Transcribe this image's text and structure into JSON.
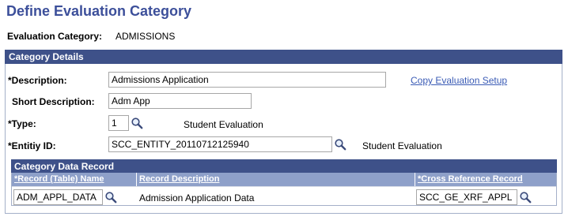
{
  "page_title": "Define Evaluation Category",
  "evaluation_category": {
    "label": "Evaluation Category:",
    "value": "ADMISSIONS"
  },
  "category_details": {
    "header": "Category Details",
    "description": {
      "label": "*Description:",
      "value": "Admissions Application"
    },
    "copy_link": "Copy Evaluation Setup",
    "short_description": {
      "label": "Short Description:",
      "value": "Adm App"
    },
    "type": {
      "label": "*Type:",
      "value": "1",
      "desc": "Student Evaluation"
    },
    "entity_id": {
      "label": "*Entitiy ID:",
      "value": "SCC_ENTITY_20110712125940",
      "desc": "Student Evaluation"
    }
  },
  "data_record": {
    "header": "Category Data Record",
    "columns": [
      "*Record (Table) Name",
      "Record Description",
      "*Cross Reference Record"
    ],
    "rows": [
      {
        "record_name": "ADM_APPL_DATA",
        "record_description": "Admission Application Data",
        "cross_reference": "SCC_GE_XRF_APPL"
      }
    ]
  },
  "icons": {
    "lookup": "magnifying-glass-icon"
  },
  "colors": {
    "title": "#3c4f9a",
    "header_bar": "#3e5189",
    "column_header": "#8ea0c9",
    "link": "#3a5bb5"
  }
}
